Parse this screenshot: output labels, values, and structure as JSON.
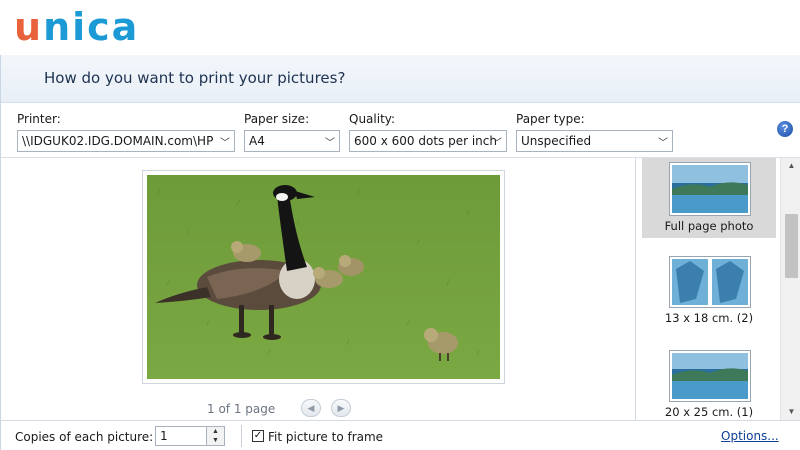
{
  "logo": {
    "first_letter": "u",
    "rest": "nica"
  },
  "dialog": {
    "question": "How do you want to print your pictures?"
  },
  "printer": {
    "label": "Printer:",
    "value": "\\\\IDGUK02.IDG.DOMAIN.com\\HP"
  },
  "paper_size": {
    "label": "Paper size:",
    "value": "A4"
  },
  "quality": {
    "label": "Quality:",
    "value": "600 x 600 dots per inch"
  },
  "paper_type": {
    "label": "Paper type:",
    "value": "Unspecified"
  },
  "help": {
    "glyph": "?",
    "icon": "help-icon"
  },
  "preview": {
    "page_count": "1 of 1 page",
    "prev_glyph": "◀",
    "next_glyph": "▶"
  },
  "layouts": [
    {
      "label": "Full page photo",
      "selected": true
    },
    {
      "label": "13 x 18 cm. (2)",
      "selected": false
    },
    {
      "label": "20 x 25 cm. (1)",
      "selected": false
    }
  ],
  "bottom": {
    "copies_label": "Copies of each picture:",
    "copies_value": "1",
    "fit_label": "Fit picture to frame",
    "fit_checked": true,
    "check_glyph": "✓",
    "options_link": "Options..."
  },
  "colors": {
    "accent": "#1b9ad6",
    "logo_orange": "#e8623b",
    "link": "#0b3f96"
  }
}
